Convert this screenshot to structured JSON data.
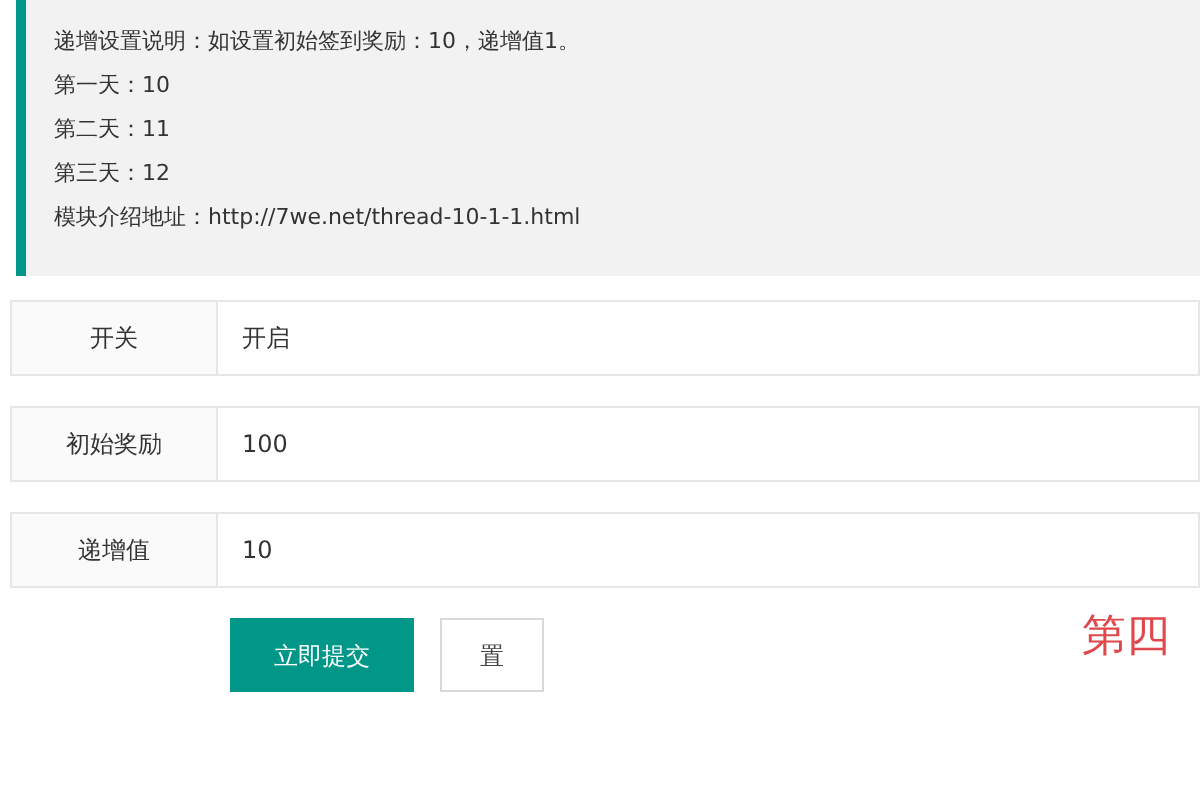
{
  "notice": {
    "lines": [
      "递增设置说明：如设置初始签到奖励：10，递增值1。",
      "第一天：10",
      "第二天：11",
      "第三天：12",
      "模块介绍地址：http://7we.net/thread-10-1-1.html"
    ]
  },
  "form": {
    "rows": [
      {
        "label": "开关",
        "value": "开启"
      },
      {
        "label": "初始奖励",
        "value": "100"
      },
      {
        "label": "递增值",
        "value": "10"
      }
    ]
  },
  "buttons": [
    {
      "label": "立即提交",
      "kind": "primary"
    },
    {
      "label": "置",
      "kind": "plain"
    }
  ],
  "step_caption": "第四"
}
